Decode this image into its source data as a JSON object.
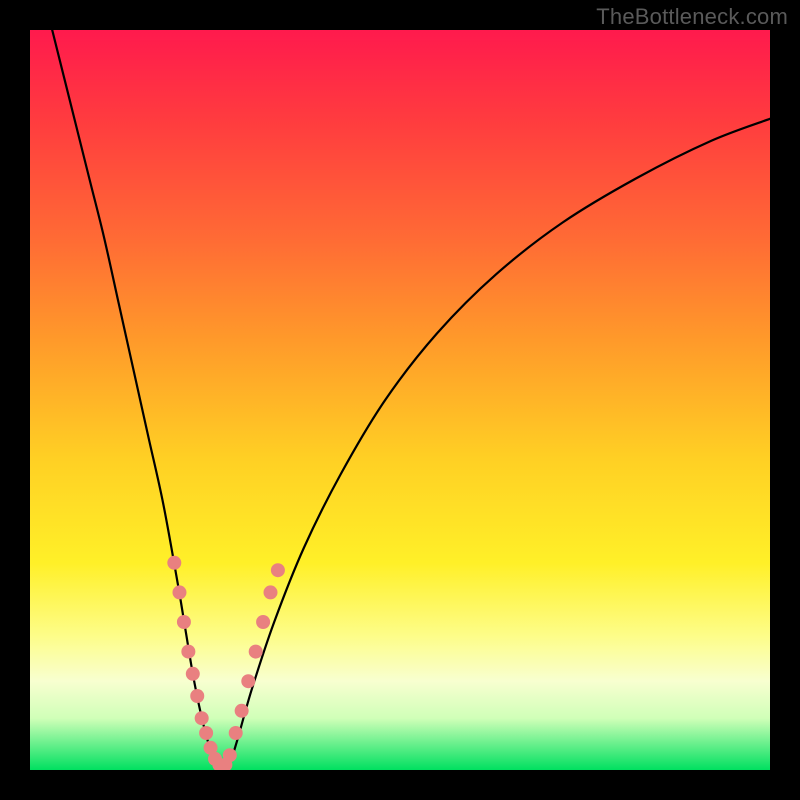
{
  "watermark": "TheBottleneck.com",
  "chart_data": {
    "type": "line",
    "title": "",
    "xlabel": "",
    "ylabel": "",
    "xlim": [
      0,
      100
    ],
    "ylim": [
      0,
      100
    ],
    "grid": false,
    "legend": false,
    "annotations": [],
    "series": [
      {
        "name": "bottleneck-curve",
        "color": "#000000",
        "x": [
          3,
          5,
          8,
          10,
          12,
          14,
          16,
          18,
          20,
          21,
          22,
          23,
          24,
          25,
          26,
          27,
          28,
          30,
          33,
          37,
          42,
          48,
          55,
          63,
          72,
          82,
          92,
          100
        ],
        "y": [
          100,
          92,
          80,
          72,
          63,
          54,
          45,
          36,
          25,
          19,
          13,
          8,
          4,
          1,
          0,
          1,
          4,
          11,
          20,
          30,
          40,
          50,
          59,
          67,
          74,
          80,
          85,
          88
        ]
      }
    ],
    "markers": [
      {
        "name": "left-cluster",
        "color": "#e98080",
        "points": [
          {
            "x": 19.5,
            "y": 28
          },
          {
            "x": 20.2,
            "y": 24
          },
          {
            "x": 20.8,
            "y": 20
          },
          {
            "x": 21.4,
            "y": 16
          },
          {
            "x": 22.0,
            "y": 13
          },
          {
            "x": 22.6,
            "y": 10
          },
          {
            "x": 23.2,
            "y": 7
          },
          {
            "x": 23.8,
            "y": 5
          },
          {
            "x": 24.4,
            "y": 3
          },
          {
            "x": 25.0,
            "y": 1.5
          },
          {
            "x": 25.6,
            "y": 0.7
          }
        ]
      },
      {
        "name": "right-cluster",
        "color": "#e98080",
        "points": [
          {
            "x": 26.4,
            "y": 0.7
          },
          {
            "x": 27.0,
            "y": 2
          },
          {
            "x": 27.8,
            "y": 5
          },
          {
            "x": 28.6,
            "y": 8
          },
          {
            "x": 29.5,
            "y": 12
          },
          {
            "x": 30.5,
            "y": 16
          },
          {
            "x": 31.5,
            "y": 20
          },
          {
            "x": 32.5,
            "y": 24
          },
          {
            "x": 33.5,
            "y": 27
          }
        ]
      }
    ]
  }
}
